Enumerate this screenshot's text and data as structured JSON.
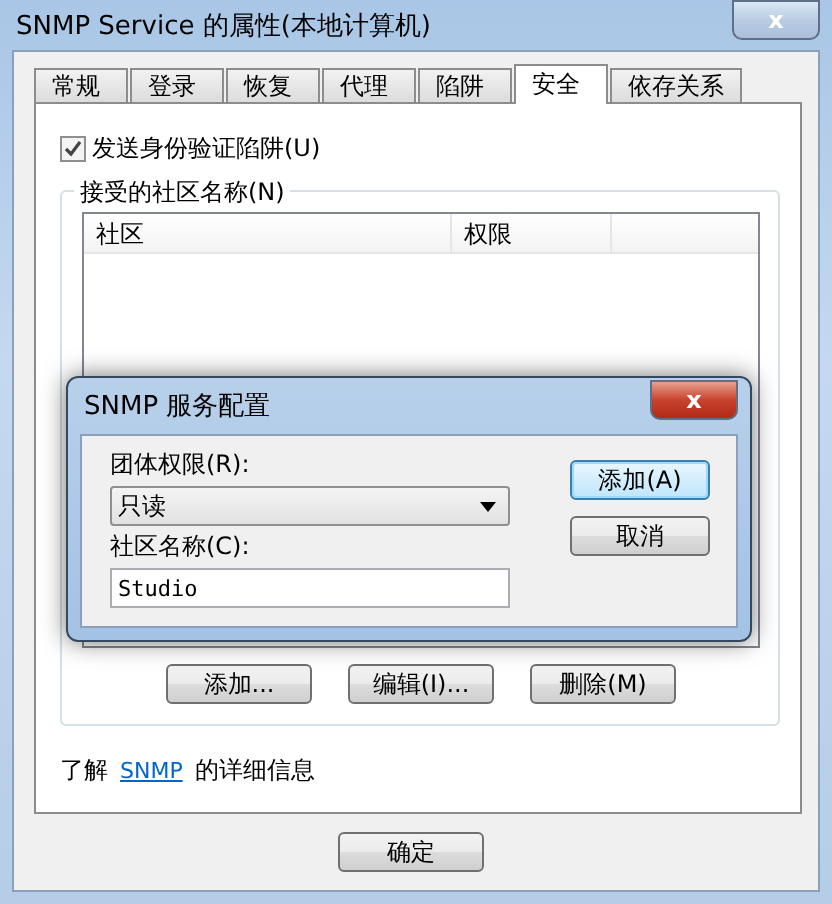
{
  "window": {
    "title": "SNMP Service 的属性(本地计算机)",
    "close": "x"
  },
  "tabs": [
    {
      "label": "常规",
      "selected": false
    },
    {
      "label": "登录",
      "selected": false
    },
    {
      "label": "恢复",
      "selected": false
    },
    {
      "label": "代理",
      "selected": false
    },
    {
      "label": "陷阱",
      "selected": false
    },
    {
      "label": "安全",
      "selected": true
    },
    {
      "label": "依存关系",
      "selected": false
    }
  ],
  "send_trap": {
    "label": "发送身份验证陷阱(U)",
    "checked": true
  },
  "communities": {
    "title": "接受的社区名称(N)",
    "columns": [
      "社区",
      "权限"
    ],
    "buttons": [
      "添加...",
      "编辑(I)...",
      "删除(M)"
    ]
  },
  "more_info": {
    "before": "了解",
    "link": "SNMP",
    "after": "的详细信息"
  },
  "footer_buttons": [
    "确定"
  ],
  "dialog": {
    "title": "SNMP 服务配置",
    "close": "x",
    "rights_label": "团体权限(R):",
    "rights_value": "只读",
    "name_label": "社区名称(C):",
    "name_value": "Studio",
    "buttons": [
      {
        "label": "添加(A)",
        "selected": true
      },
      {
        "label": "取消",
        "selected": false
      }
    ]
  }
}
